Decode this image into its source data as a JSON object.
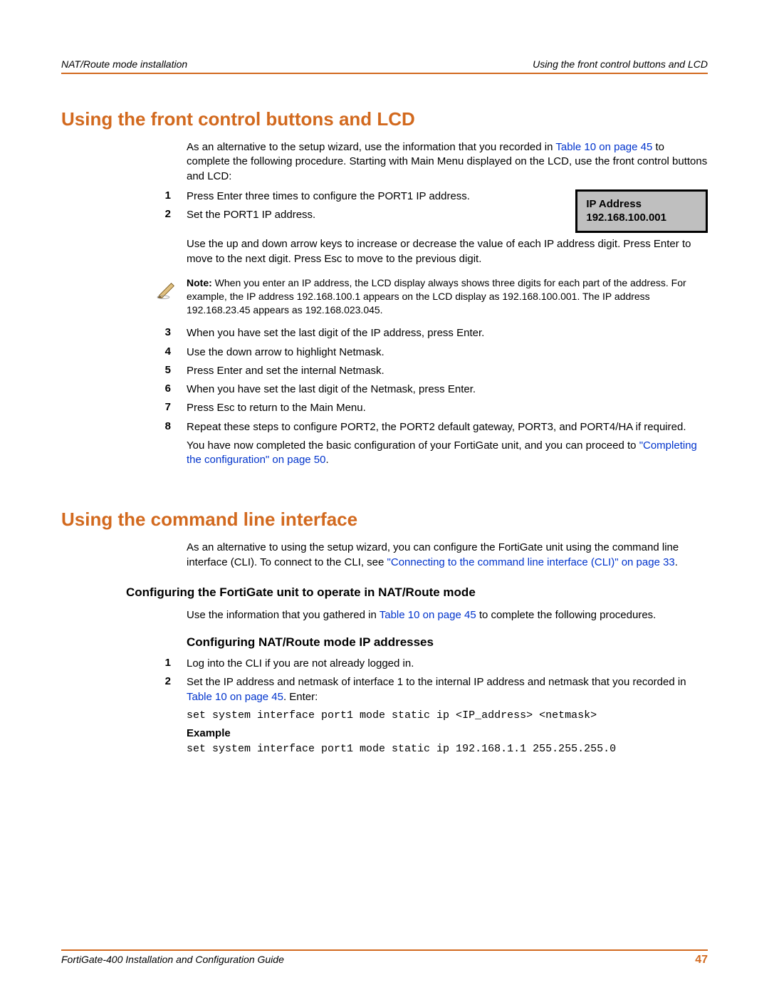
{
  "header": {
    "left": "NAT/Route mode installation",
    "right": "Using the front control buttons and LCD"
  },
  "section1": {
    "title": "Using the front control buttons and LCD",
    "intro_pre": "As an alternative to the setup wizard, use the information that you recorded in ",
    "intro_link": "Table 10 on page 45",
    "intro_post": " to complete the following procedure. Starting with Main Menu displayed on the LCD, use the front control buttons and LCD:",
    "steps": {
      "s1": "Press Enter three times to configure the PORT1 IP address.",
      "s2": "Set the PORT1 IP address.",
      "s2_after": "Use the up and down arrow keys to increase or decrease the value of each IP address digit. Press Enter to move to the next digit. Press Esc to move to the previous digit.",
      "s3": "When you have set the last digit of the IP address, press Enter.",
      "s4": "Use the down arrow to highlight Netmask.",
      "s5": "Press Enter and set the internal Netmask.",
      "s6": "When you have set the last digit of the Netmask, press Enter.",
      "s7": "Press Esc to return to the Main Menu.",
      "s8": "Repeat these steps to configure PORT2, the PORT2 default gateway, PORT3, and PORT4/HA if required.",
      "s8_after_pre": "You have now completed the basic configuration of your FortiGate unit, and you can proceed to ",
      "s8_after_link": "\"Completing the configuration\" on page 50",
      "s8_after_post": "."
    },
    "lcd": {
      "line1": "IP Address",
      "line2": "192.168.100.001"
    },
    "note_label": "Note:",
    "note_body": " When you enter an IP address, the LCD display always shows three digits for each part of the address. For example, the IP address 192.168.100.1 appears on the LCD display as 192.168.100.001. The IP address 192.168.23.45 appears as 192.168.023.045."
  },
  "section2": {
    "title": "Using the command line interface",
    "intro_pre": "As an alternative to using the setup wizard, you can configure the FortiGate unit using the command line interface (CLI). To connect to the CLI, see ",
    "intro_link": "\"Connecting to the command line interface (CLI)\" on page 33",
    "intro_post": ".",
    "subhead1": "Configuring the FortiGate unit to operate in NAT/Route mode",
    "sub1_pre": "Use the information that you gathered in ",
    "sub1_link": "Table 10 on page 45",
    "sub1_post": " to complete the following procedures.",
    "subhead2": "Configuring NAT/Route mode IP addresses",
    "steps": {
      "s1": "Log into the CLI if you are not already logged in.",
      "s2_pre": "Set the IP address and netmask of interface 1 to the internal IP address and netmask that you recorded in ",
      "s2_link": "Table 10 on page 45",
      "s2_post": ". Enter:"
    },
    "code1": "set system interface port1 mode static ip <IP_address> <netmask>",
    "example_label": "Example",
    "code2": "set system interface port1 mode static ip 192.168.1.1 255.255.255.0"
  },
  "footer": {
    "left": "FortiGate-400 Installation and Configuration Guide",
    "page": "47"
  },
  "labels": {
    "n1": "1",
    "n2": "2",
    "n3": "3",
    "n4": "4",
    "n5": "5",
    "n6": "6",
    "n7": "7",
    "n8": "8"
  }
}
